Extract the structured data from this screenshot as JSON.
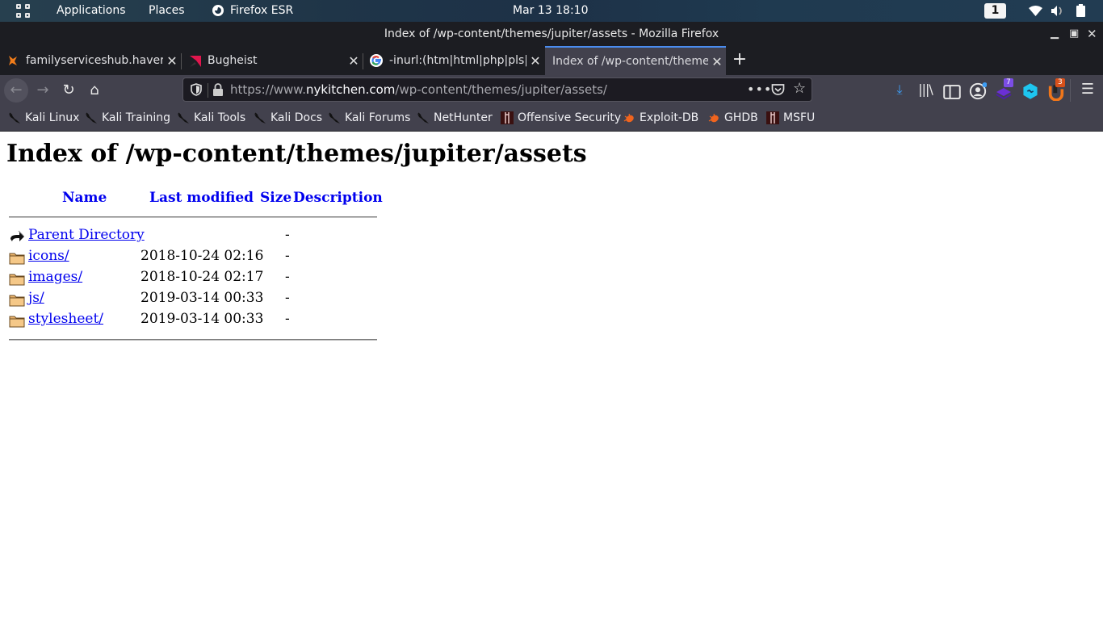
{
  "system_panel": {
    "applications_label": "Applications",
    "places_label": "Places",
    "active_app_label": "Firefox ESR",
    "clock": "Mar 13  18:10",
    "workspace_number": "1"
  },
  "window": {
    "title": "Index of /wp-content/themes/jupiter/assets - Mozilla Firefox"
  },
  "tabs": [
    {
      "label": "familyserviceshub.havering",
      "favicon": "kali-dragon-orange",
      "active": false
    },
    {
      "label": "Bugheist",
      "favicon": "bugheist-red",
      "active": false
    },
    {
      "label": "-inurl:(htm|html|php|pls|",
      "favicon": "google-g",
      "active": false
    },
    {
      "label": "Index of /wp-content/themes",
      "favicon": "none",
      "active": true
    }
  ],
  "toolbar": {
    "url_prefix": "https://www.",
    "url_host": "nykitchen.com",
    "url_path": "/wp-content/themes/jupiter/assets/",
    "extension_badge_1": "7",
    "extension_badge_2": "3",
    "accent_color": "#4a8cf0"
  },
  "bookmarks": [
    {
      "label": "Kali Linux",
      "icon": "kali-dragon-icon"
    },
    {
      "label": "Kali Training",
      "icon": "kali-dragon-icon"
    },
    {
      "label": "Kali Tools",
      "icon": "kali-dragon-icon"
    },
    {
      "label": "Kali Docs",
      "icon": "kali-dragon-icon"
    },
    {
      "label": "Kali Forums",
      "icon": "kali-dragon-icon"
    },
    {
      "label": "NetHunter",
      "icon": "kali-dragon-icon"
    },
    {
      "label": "Offensive Security",
      "icon": "offsec-icon"
    },
    {
      "label": "Exploit-DB",
      "icon": "exploitdb-bug-icon"
    },
    {
      "label": "GHDB",
      "icon": "exploitdb-bug-icon"
    },
    {
      "label": "MSFU",
      "icon": "offsec-icon"
    }
  ],
  "page": {
    "heading": "Index of /wp-content/themes/jupiter/assets",
    "columns": {
      "name": "Name",
      "last_modified": "Last modified",
      "size": "Size",
      "description": "Description"
    },
    "entries": [
      {
        "name": "Parent Directory",
        "last_modified": "",
        "size": "-",
        "icon": "back-icon"
      },
      {
        "name": "icons/",
        "last_modified": "2018-10-24 02:16",
        "size": "-",
        "icon": "folder-icon"
      },
      {
        "name": "images/",
        "last_modified": "2018-10-24 02:17",
        "size": "-",
        "icon": "folder-icon"
      },
      {
        "name": "js/",
        "last_modified": "2019-03-14 00:33",
        "size": "-",
        "icon": "folder-icon"
      },
      {
        "name": "stylesheet/",
        "last_modified": "2019-03-14 00:33",
        "size": "-",
        "icon": "folder-icon"
      }
    ]
  }
}
